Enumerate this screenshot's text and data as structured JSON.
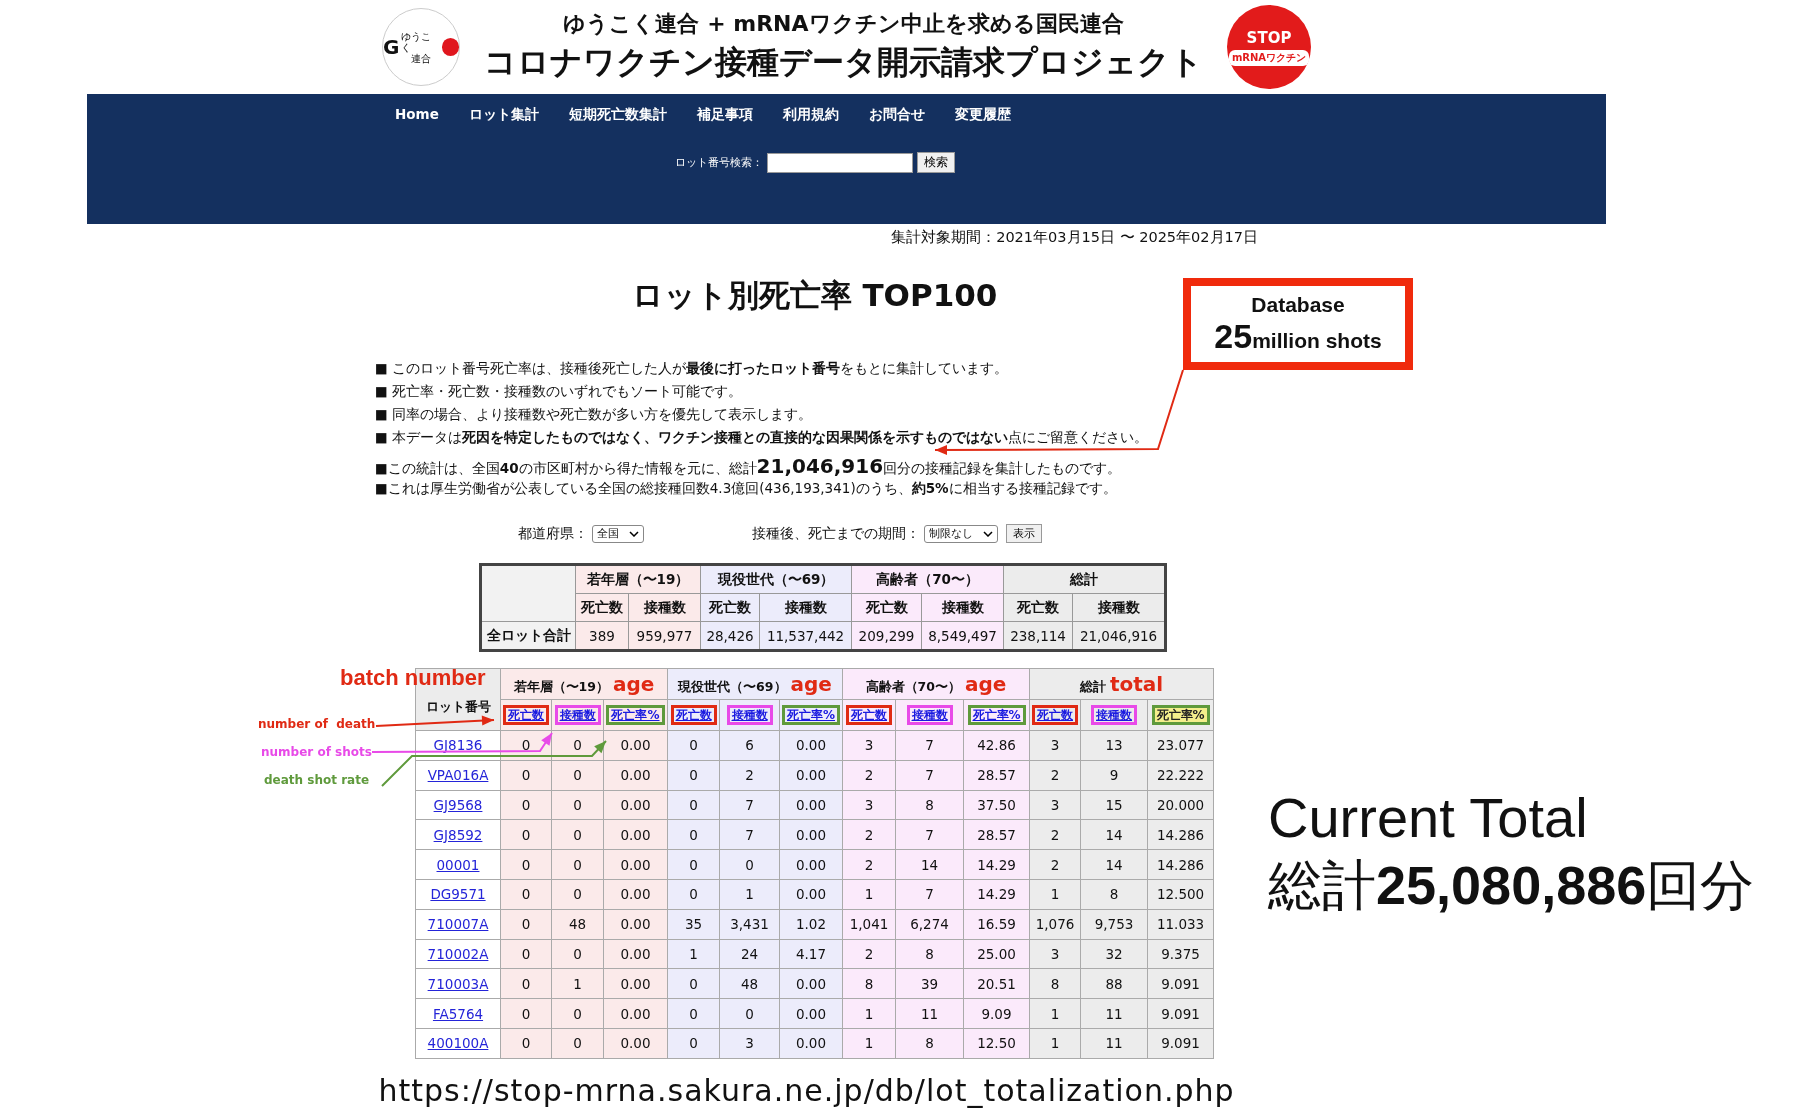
{
  "header": {
    "logo": {
      "mark": "G",
      "text": "ゆうこく",
      "sub": "連合"
    },
    "subtitle": "ゆうこく連合 + mRNAワクチン中止を求める国民連合",
    "title": "コロナワクチン接種データ開示請求プロジェクト",
    "badge": {
      "top": "STOP",
      "bottom": "mRNAワクチン"
    }
  },
  "nav": {
    "items": [
      "Home",
      "ロット集計",
      "短期死亡数集計",
      "補足事項",
      "利用規約",
      "お問合せ",
      "変更履歴"
    ],
    "search": {
      "label": "ロット番号検索：",
      "button": "検索"
    }
  },
  "period": "集計対象期間：2021年03月15日 〜 2025年02月17日",
  "page_title": "ロット別死亡率 TOP100",
  "notes": [
    {
      "kind": "plain",
      "text": "■ このロット番号死亡率は、接種後死亡した人が**最後に打ったロット番号**をもとに集計しています。"
    },
    {
      "kind": "plain",
      "text": "■ 死亡率・死亡数・接種数のいずれでもソート可能です。"
    },
    {
      "kind": "plain",
      "text": "■ 同率の場合、より接種数や死亡数が多い方を優先して表示します。"
    },
    {
      "kind": "plain",
      "text": "■ 本データは**死因を特定したものではなく、ワクチン接種との直接的な因果関係を示すものではない**点にご留意ください。"
    },
    {
      "kind": "figure",
      "before": "■この統計は、全国**40**の市区町村から得た情報を元に、総計",
      "figure": "21,046,916",
      "after": "回分の接種記録を集計したものです。"
    },
    {
      "kind": "plain",
      "text": "■これは厚生労働省が公表している全国の総接種回数4.3億回(436,193,341)のうち、**約5%**に相当する接種記録です。"
    }
  ],
  "filters": {
    "prefecture": {
      "label": "都道府県：",
      "value": "全国"
    },
    "interval": {
      "label": "接種後、死亡までの期間：",
      "value": "制限なし"
    },
    "button": "表示"
  },
  "summary": {
    "groups": [
      {
        "label": "若年層（〜19）",
        "color": "#fbeaea"
      },
      {
        "label": "現役世代（〜69）",
        "color": "#ececfb"
      },
      {
        "label": "高齢者（70〜）",
        "color": "#fbeafb"
      },
      {
        "label": "総計",
        "color": "#ececec"
      }
    ],
    "columns": [
      "死亡数",
      "接種数",
      "死亡数",
      "接種数",
      "死亡数",
      "接種数",
      "死亡数",
      "接種数"
    ],
    "row": {
      "label": "全ロット合計",
      "values": [
        "389",
        "959,977",
        "28,426",
        "11,537,442",
        "209,299",
        "8,549,497",
        "238,114",
        "21,046,916"
      ]
    }
  },
  "lots": {
    "lot_header": "ロット番号",
    "groups": [
      {
        "label": "若年層（〜19）",
        "note": "age",
        "color": "#fbeaea"
      },
      {
        "label": "現役世代（〜69）",
        "note": "age",
        "color": "#ececfb"
      },
      {
        "label": "高齢者（70〜）",
        "note": "age",
        "color": "#fbeafb"
      },
      {
        "label": "総計",
        "note": "total",
        "color": "#ececec"
      }
    ],
    "columns": [
      {
        "label": "死亡数",
        "color": "#e02a14",
        "selected": false
      },
      {
        "label": "接種数",
        "color": "#e84ae8",
        "selected": false
      },
      {
        "label": "死亡率%",
        "color": "#5f9a3c",
        "selected": false
      },
      {
        "label": "死亡数",
        "color": "#e02a14",
        "selected": false
      },
      {
        "label": "接種数",
        "color": "#e84ae8",
        "selected": false
      },
      {
        "label": "死亡率%",
        "color": "#5f9a3c",
        "selected": false
      },
      {
        "label": "死亡数",
        "color": "#e02a14",
        "selected": false
      },
      {
        "label": "接種数",
        "color": "#e84ae8",
        "selected": false
      },
      {
        "label": "死亡率%",
        "color": "#5f9a3c",
        "selected": false
      },
      {
        "label": "死亡数",
        "color": "#e02a14",
        "selected": false
      },
      {
        "label": "接種数",
        "color": "#e84ae8",
        "selected": false
      },
      {
        "label": "死亡率%",
        "color": "#5f9a3c",
        "selected": true
      }
    ],
    "rows": [
      {
        "lot": "GJ8136",
        "values": [
          "0",
          "0",
          "0.00",
          "0",
          "6",
          "0.00",
          "3",
          "7",
          "42.86",
          "3",
          "13",
          "23.077"
        ]
      },
      {
        "lot": "VPA016A",
        "values": [
          "0",
          "0",
          "0.00",
          "0",
          "2",
          "0.00",
          "2",
          "7",
          "28.57",
          "2",
          "9",
          "22.222"
        ]
      },
      {
        "lot": "GJ9568",
        "values": [
          "0",
          "0",
          "0.00",
          "0",
          "7",
          "0.00",
          "3",
          "8",
          "37.50",
          "3",
          "15",
          "20.000"
        ]
      },
      {
        "lot": "GJ8592",
        "values": [
          "0",
          "0",
          "0.00",
          "0",
          "7",
          "0.00",
          "2",
          "7",
          "28.57",
          "2",
          "14",
          "14.286"
        ]
      },
      {
        "lot": "00001",
        "values": [
          "0",
          "0",
          "0.00",
          "0",
          "0",
          "0.00",
          "2",
          "14",
          "14.29",
          "2",
          "14",
          "14.286"
        ]
      },
      {
        "lot": "DG9571",
        "values": [
          "0",
          "0",
          "0.00",
          "0",
          "1",
          "0.00",
          "1",
          "7",
          "14.29",
          "1",
          "8",
          "12.500"
        ]
      },
      {
        "lot": "710007A",
        "values": [
          "0",
          "48",
          "0.00",
          "35",
          "3,431",
          "1.02",
          "1,041",
          "6,274",
          "16.59",
          "1,076",
          "9,753",
          "11.033"
        ]
      },
      {
        "lot": "710002A",
        "values": [
          "0",
          "0",
          "0.00",
          "1",
          "24",
          "4.17",
          "2",
          "8",
          "25.00",
          "3",
          "32",
          "9.375"
        ]
      },
      {
        "lot": "710003A",
        "values": [
          "0",
          "1",
          "0.00",
          "0",
          "48",
          "0.00",
          "8",
          "39",
          "20.51",
          "8",
          "88",
          "9.091"
        ]
      },
      {
        "lot": "FA5764",
        "values": [
          "0",
          "0",
          "0.00",
          "0",
          "0",
          "0.00",
          "1",
          "11",
          "9.09",
          "1",
          "11",
          "9.091"
        ]
      },
      {
        "lot": "400100A",
        "values": [
          "0",
          "0",
          "0.00",
          "0",
          "3",
          "0.00",
          "1",
          "8",
          "12.50",
          "1",
          "11",
          "9.091"
        ]
      }
    ]
  },
  "annotations": {
    "batch": "batch number",
    "labels": [
      {
        "text": "number of  death",
        "color": "#e02a14"
      },
      {
        "text": "number of shots",
        "color": "#e84ae8"
      },
      {
        "text": "death shot rate",
        "color": "#5f9a3c"
      }
    ],
    "callout": {
      "line1": "Database",
      "figure": "25",
      "line2": "million shots"
    },
    "total": {
      "line1": "Current Total",
      "line2": "総計**25,080,886**回分"
    },
    "url": "https://stop-mrna.sakura.ne.jp/db/lot_totalization.php"
  }
}
